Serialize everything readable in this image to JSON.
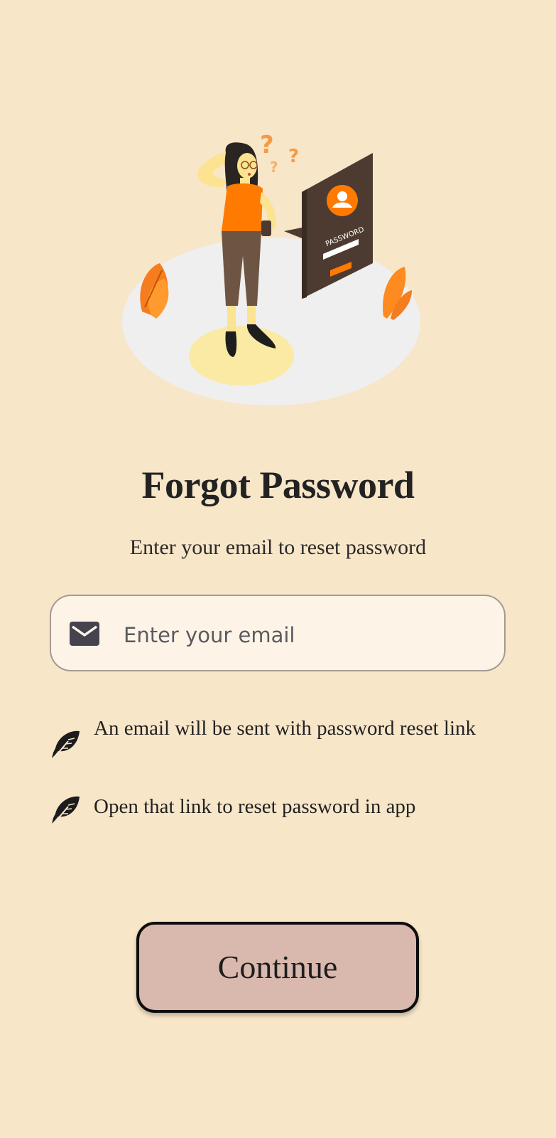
{
  "screen": {
    "title": "Forgot Password",
    "subtitle": "Enter your email to reset password"
  },
  "email_field": {
    "placeholder": "Enter your email",
    "value": "",
    "icon": "mail-icon"
  },
  "notes": [
    {
      "icon": "feather-icon",
      "text": "An email will be sent with password reset link"
    },
    {
      "icon": "feather-icon",
      "text": "Open that link to reset password in app"
    }
  ],
  "illustration": {
    "password_label": "PASSWORD"
  },
  "actions": {
    "continue_label": "Continue"
  },
  "colors": {
    "background": "#f8e6c9",
    "input_background": "#fdf4e7",
    "button_background": "#d9b9ad",
    "accent_orange": "#ff7a00"
  }
}
